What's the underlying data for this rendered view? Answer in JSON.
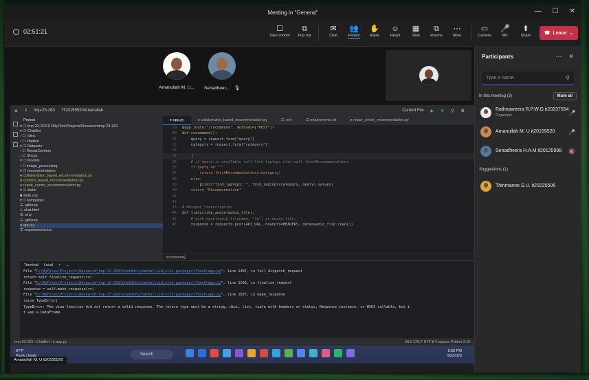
{
  "window": {
    "title": "Meeting in \"General\"",
    "controls": [
      "—",
      "☐",
      "✕"
    ]
  },
  "toolbar": {
    "timer": "02:51:21",
    "buttons": [
      {
        "label": "Take control",
        "icon": "☐"
      },
      {
        "label": "Pop out",
        "icon": "⧉"
      },
      {
        "label": "Chat",
        "icon": "✉"
      },
      {
        "label": "People",
        "icon": "👥"
      },
      {
        "label": "Raise",
        "icon": "✋"
      },
      {
        "label": "React",
        "icon": "☺"
      },
      {
        "label": "View",
        "icon": "▦"
      },
      {
        "label": "Rooms",
        "icon": "⧉"
      },
      {
        "label": "More",
        "icon": "⋯"
      },
      {
        "label": "Camera",
        "icon": "▭"
      },
      {
        "label": "Mic",
        "icon": "🎤"
      },
      {
        "label": "Share",
        "icon": "⬆"
      }
    ],
    "leave_label": "Leave",
    "leave_icon": "☎"
  },
  "gallery": {
    "participants": [
      {
        "name": "Amanullah M. U...",
        "muted": false
      },
      {
        "name": "Senadheer...",
        "muted": true
      }
    ]
  },
  "ide": {
    "project": "tmp-23-263",
    "vcs": "IT20155520Amanullah",
    "run_config": "Current File",
    "project_label": "Project",
    "tree": [
      "▾ ☐ tmp-23-263  D:\\MyFiles\\Projects\\Research\\tmp-23-263",
      "  ▾ ☐ ChatBot",
      "    › ☐ .idea",
      "    › ☐ chatbot",
      "    ▾ ☐ Datasets",
      "      › ☐ RepairCenters",
      "      › ☐ Shops",
      "    ▾ ☐ models",
      "      › ☐ image_processing",
      "      ▾ ☐ recommendation",
      "          ● collaborative_based_recommendation.py",
      "          ● content_based_recommendation.py",
      "          ● repair_center_recommendation.py",
      "    ▾ ☐ static",
      "        ■ style.css",
      "    ▾ ☐ templates",
      "        ☰ .gitkeep",
      "        ◇ chat.html",
      "      ☰ .env",
      "      ☰ .gitkeep",
      "      ● app.py",
      "      ☰ requirements.txt"
    ],
    "tabs": [
      "● app.py",
      "● collaborative_based_recommendation.py",
      "☰ .env",
      "☰ requirements.txt",
      "● repair_center_recommendation.py"
    ],
    "code": [
      {
        "n": "29",
        "t": "@app.route(\"/recommend\", methods=[\"POST\"])"
      },
      {
        "n": "30",
        "t": "def recommend():"
      },
      {
        "n": "31",
        "t": "    query = request.form[\"query\"]"
      },
      {
        "n": "32",
        "t": "    category = request.form[\"category\"]"
      },
      {
        "n": "33",
        "t": ""
      },
      {
        "n": "34",
        "t": "    |"
      },
      {
        "n": "35",
        "t": "    # if query is available call find_laptops else call fetchRecommendations"
      },
      {
        "n": "36",
        "t": "    if query == \"\":"
      },
      {
        "n": "37",
        "t": "        return fetchRecommendations(category)"
      },
      {
        "n": "38",
        "t": "    else:"
      },
      {
        "n": "39",
        "t": "        print(\"find_laptops: \", find_laptops(category, query).values)"
      },
      {
        "n": "40",
        "t": "    return \"Recommendation\""
      },
      {
        "n": "41",
        "t": ""
      },
      {
        "n": "42",
        "t": ""
      },
      {
        "n": "43",
        "t": "# Whisper transcription"
      },
      {
        "n": "44",
        "t": "def transcribe_audio(audio_file):"
      },
      {
        "n": "45",
        "t": "    # with open(audio_filename, \"rb\") as audio_file:"
      },
      {
        "n": "46",
        "t": "    response = requests.post(API_URL, headers=HEADERS, data=audio_file.read())"
      }
    ],
    "breadcrumb": "recommend()",
    "terminal_tabs": [
      "Terminal",
      "Local",
      "+",
      "⌄"
    ],
    "terminal": [
      {
        "pre": "  File \"",
        "link": "D:\\MyFiles\\Projects\\Research\\tmp-23-263\\ChatBot\\chatbot\\Lib\\site-packages\\flask\\app.py",
        "post": "\", line 1487, in full_dispatch_request"
      },
      {
        "pre": "    return self.finalize_request(rv)",
        "link": "",
        "post": ""
      },
      {
        "pre": "  File \"",
        "link": "D:\\MyFiles\\Projects\\Research\\tmp-23-263\\ChatBot\\chatbot\\Lib\\site-packages\\flask\\app.py",
        "post": "\", line 1506, in finalize_request"
      },
      {
        "pre": "    response = self.make_response(rv)",
        "link": "",
        "post": ""
      },
      {
        "pre": "  File \"",
        "link": "D:\\MyFiles\\Projects\\Research\\tmp-23-263\\ChatBot\\chatbot\\Lib\\site-packages\\flask\\app.py",
        "post": "\", line 1837, in make_response"
      },
      {
        "pre": "    raise TypeError(",
        "link": "",
        "post": ""
      },
      {
        "pre": "TypeError: The view function did not return a valid response. The return type must be a string, dict, list, tuple with headers or status, Response instance, or WSGI callable, but i",
        "link": "",
        "post": ""
      },
      {
        "pre": "t was a DataFrame.",
        "link": "",
        "post": ""
      }
    ],
    "status_left": "tmp-23-263  ›  ChatBot  ›  ● app.py",
    "status_right": "58:5   CRLF   UTF-8   4 spaces   Python 3.10"
  },
  "taskbar": {
    "weather_temp": "87°F",
    "weather_desc": "Partly cloudy",
    "search": "Search",
    "time": "8:55 PM",
    "date": "9/2/2023",
    "app_colors": [
      "#3d7ee0",
      "#2b6fd6",
      "#d94f3d",
      "#4a9be8",
      "#8a58d6",
      "#e0a43a",
      "#d04a4a",
      "#3aa0e0",
      "#5ab04f",
      "#4f86e8",
      "#3fb0d0",
      "#e05a8a",
      "#2fb36b",
      "#7c6fe0"
    ]
  },
  "presenter_tag": "Amanullah M. U it20155520",
  "panel": {
    "title": "Participants",
    "search_placeholder": "Type a name",
    "in_meeting_label": "In this meeting (3)",
    "mute_all": "Mute all",
    "members": [
      {
        "name": "Rathnaweera R.P.W.G it20237554",
        "role": "Organizer",
        "mic": "🎤",
        "color": "#e8e8e8"
      },
      {
        "name": "Amanullah M. U it20155520",
        "role": "",
        "mic": "🎤",
        "color": "#c9895f"
      },
      {
        "name": "Senadheera H.A.M it20125998",
        "role": "",
        "mic": "🔇",
        "color": "#4d79a8"
      }
    ],
    "suggestions_label": "Suggestions (1)",
    "suggestions": [
      {
        "name": "Thirimanne S.U. it20225506",
        "color": "#d9a441"
      }
    ]
  },
  "colors": {
    "accent": "#7f85f5",
    "leave": "#c4314b",
    "ide_bg": "#1e1f22"
  }
}
